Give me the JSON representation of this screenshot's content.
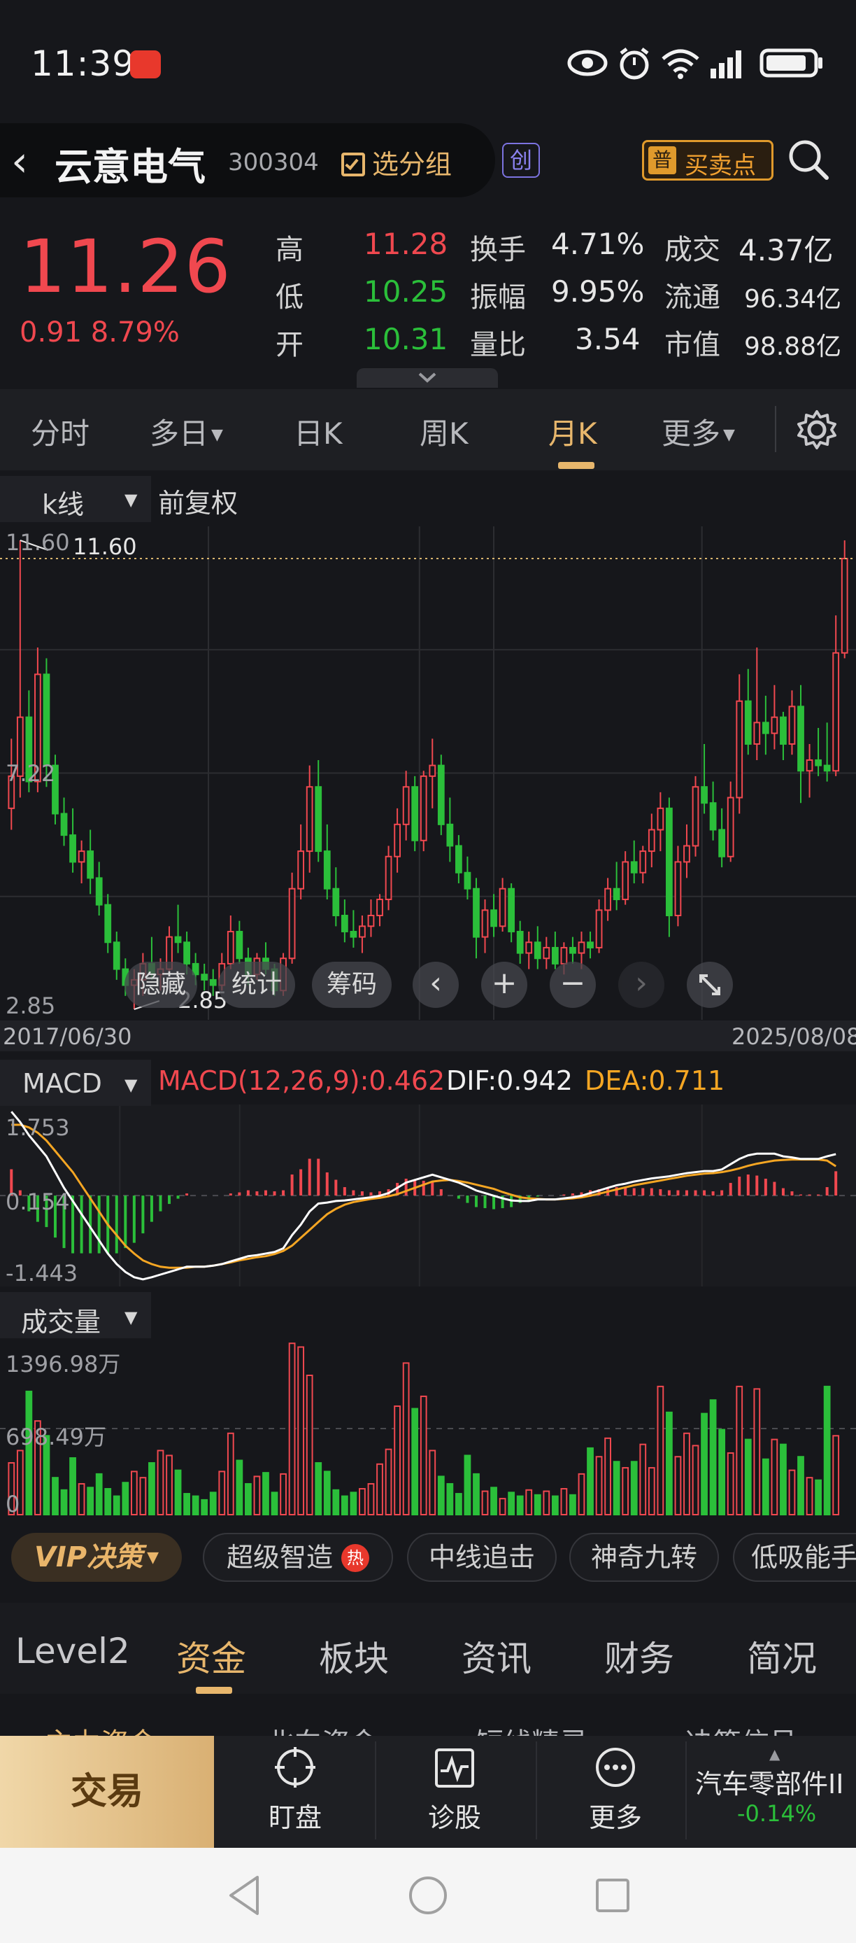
{
  "status_bar": {
    "time": "11:39"
  },
  "header": {
    "name": "云意电气",
    "code": "300304",
    "group_button": "选分组",
    "board_badge": "创",
    "buysell_icon": "普",
    "buysell_label": "买卖点"
  },
  "quote": {
    "price": "11.26",
    "change": "0.91",
    "change_pct": "8.79%",
    "high_label": "高",
    "high": "11.28",
    "low_label": "低",
    "low": "10.25",
    "open_label": "开",
    "open": "10.31",
    "turnover_label": "换手",
    "turnover": "4.71%",
    "amplitude_label": "振幅",
    "amplitude": "9.95%",
    "volratio_label": "量比",
    "volratio": "3.54",
    "amount_label": "成交",
    "amount": "4.37亿",
    "float_label": "流通",
    "float": "96.34亿",
    "mktcap_label": "市值",
    "mktcap": "98.88亿",
    "up_color": "#f0484f",
    "down_color": "#2bbf3a"
  },
  "timeframe_tabs": [
    "分时",
    "多日",
    "日K",
    "周K",
    "月K",
    "更多"
  ],
  "active_timeframe": "月K",
  "kline": {
    "type_select": "k线",
    "adjust": "前复权",
    "price_labels": {
      "top": "11.60",
      "mid": "7.22",
      "bottom": "2.85"
    },
    "max_marker": "11.60",
    "min_marker": "2.85",
    "start_date": "2017/06/30",
    "end_date": "2025/08/08",
    "overlay": {
      "hide": "隐藏",
      "stats": "统计",
      "chips": "筹码"
    }
  },
  "macd": {
    "select": "MACD",
    "label": "MACD(12,26,9):0.462",
    "dif": "DIF:0.942",
    "dea": "DEA:0.711",
    "axis": {
      "top": "1.753",
      "mid": "0.154",
      "bottom": "-1.443"
    },
    "dif_color": "#ffffff",
    "dea_color": "#f5a623"
  },
  "volume": {
    "select": "成交量",
    "axis": {
      "top": "1396.98万",
      "mid": "698.49万",
      "bottom": "0"
    }
  },
  "chips": {
    "vip": "VIP决策",
    "items": [
      "超级智造",
      "中线追击",
      "神奇九转",
      "低吸能手"
    ],
    "hot_badge": "热"
  },
  "lower_tabs": [
    "Level2",
    "资金",
    "板块",
    "资讯",
    "财务",
    "简况"
  ],
  "active_lower_tab": "资金",
  "sub_tabs": [
    "主力资金",
    "北向资金",
    "短线精灵",
    "决策信号"
  ],
  "action_bar": {
    "trade": "交易",
    "watch": "盯盘",
    "diagnose": "诊股",
    "more": "更多",
    "sector_name": "汽车零部件II",
    "sector_change": "-0.14%"
  },
  "chart_data": {
    "type": "candlestick",
    "title": "",
    "period": "monthly",
    "x_start": "2017/06/30",
    "x_end": "2025/08/08",
    "ylim": [
      2.85,
      11.6
    ],
    "candles": [
      {
        "o": 6.6,
        "h": 7.9,
        "l": 6.2,
        "c": 7.2
      },
      {
        "o": 7.2,
        "h": 11.6,
        "l": 6.8,
        "c": 8.3
      },
      {
        "o": 8.3,
        "h": 8.8,
        "l": 6.9,
        "c": 7.1
      },
      {
        "o": 7.1,
        "h": 9.6,
        "l": 6.9,
        "c": 9.1
      },
      {
        "o": 9.1,
        "h": 9.4,
        "l": 7.0,
        "c": 7.4
      },
      {
        "o": 7.4,
        "h": 7.6,
        "l": 6.3,
        "c": 6.5
      },
      {
        "o": 6.5,
        "h": 6.8,
        "l": 5.9,
        "c": 6.1
      },
      {
        "o": 6.1,
        "h": 6.6,
        "l": 5.4,
        "c": 5.6
      },
      {
        "o": 5.6,
        "h": 6.0,
        "l": 5.2,
        "c": 5.8
      },
      {
        "o": 5.8,
        "h": 6.2,
        "l": 5.0,
        "c": 5.3
      },
      {
        "o": 5.3,
        "h": 5.6,
        "l": 4.6,
        "c": 4.8
      },
      {
        "o": 4.8,
        "h": 5.0,
        "l": 3.9,
        "c": 4.1
      },
      {
        "o": 4.1,
        "h": 4.3,
        "l": 3.4,
        "c": 3.6
      },
      {
        "o": 3.6,
        "h": 3.8,
        "l": 3.1,
        "c": 3.3
      },
      {
        "o": 3.3,
        "h": 3.6,
        "l": 2.85,
        "c": 3.4
      },
      {
        "o": 3.4,
        "h": 3.9,
        "l": 3.1,
        "c": 3.7
      },
      {
        "o": 3.7,
        "h": 4.2,
        "l": 3.4,
        "c": 3.5
      },
      {
        "o": 3.5,
        "h": 3.8,
        "l": 3.2,
        "c": 3.6
      },
      {
        "o": 3.6,
        "h": 4.4,
        "l": 3.5,
        "c": 4.2
      },
      {
        "o": 4.2,
        "h": 4.8,
        "l": 3.9,
        "c": 4.1
      },
      {
        "o": 4.1,
        "h": 4.3,
        "l": 3.5,
        "c": 3.7
      },
      {
        "o": 3.7,
        "h": 3.9,
        "l": 3.3,
        "c": 3.5
      },
      {
        "o": 3.5,
        "h": 3.7,
        "l": 3.2,
        "c": 3.4
      },
      {
        "o": 3.4,
        "h": 3.6,
        "l": 3.1,
        "c": 3.3
      },
      {
        "o": 3.3,
        "h": 3.9,
        "l": 3.2,
        "c": 3.7
      },
      {
        "o": 3.7,
        "h": 4.6,
        "l": 3.6,
        "c": 4.3
      },
      {
        "o": 4.3,
        "h": 4.5,
        "l": 3.7,
        "c": 3.8
      },
      {
        "o": 3.8,
        "h": 4.0,
        "l": 3.3,
        "c": 3.5
      },
      {
        "o": 3.5,
        "h": 3.9,
        "l": 3.4,
        "c": 3.8
      },
      {
        "o": 3.8,
        "h": 4.1,
        "l": 3.5,
        "c": 3.6
      },
      {
        "o": 3.6,
        "h": 3.7,
        "l": 3.1,
        "c": 3.2
      },
      {
        "o": 3.2,
        "h": 3.9,
        "l": 3.1,
        "c": 3.8
      },
      {
        "o": 3.8,
        "h": 5.4,
        "l": 3.7,
        "c": 5.1
      },
      {
        "o": 5.1,
        "h": 6.3,
        "l": 4.9,
        "c": 5.8
      },
      {
        "o": 5.8,
        "h": 7.4,
        "l": 5.4,
        "c": 7.0
      },
      {
        "o": 7.0,
        "h": 7.5,
        "l": 5.6,
        "c": 5.8
      },
      {
        "o": 5.8,
        "h": 6.3,
        "l": 4.9,
        "c": 5.1
      },
      {
        "o": 5.1,
        "h": 5.5,
        "l": 4.4,
        "c": 4.6
      },
      {
        "o": 4.6,
        "h": 4.9,
        "l": 4.1,
        "c": 4.3
      },
      {
        "o": 4.3,
        "h": 4.7,
        "l": 4.0,
        "c": 4.2
      },
      {
        "o": 4.2,
        "h": 4.6,
        "l": 3.9,
        "c": 4.4
      },
      {
        "o": 4.4,
        "h": 4.9,
        "l": 4.2,
        "c": 4.6
      },
      {
        "o": 4.6,
        "h": 5.0,
        "l": 4.4,
        "c": 4.9
      },
      {
        "o": 4.9,
        "h": 5.9,
        "l": 4.7,
        "c": 5.7
      },
      {
        "o": 5.7,
        "h": 6.6,
        "l": 5.4,
        "c": 6.3
      },
      {
        "o": 6.3,
        "h": 7.3,
        "l": 6.0,
        "c": 7.0
      },
      {
        "o": 7.0,
        "h": 7.2,
        "l": 5.8,
        "c": 6.0
      },
      {
        "o": 6.0,
        "h": 7.3,
        "l": 5.8,
        "c": 7.2
      },
      {
        "o": 7.2,
        "h": 7.9,
        "l": 6.6,
        "c": 7.4
      },
      {
        "o": 7.4,
        "h": 7.6,
        "l": 6.1,
        "c": 6.3
      },
      {
        "o": 6.3,
        "h": 6.8,
        "l": 5.6,
        "c": 5.9
      },
      {
        "o": 5.9,
        "h": 6.1,
        "l": 5.2,
        "c": 5.4
      },
      {
        "o": 5.4,
        "h": 5.7,
        "l": 4.9,
        "c": 5.1
      },
      {
        "o": 5.1,
        "h": 5.3,
        "l": 3.8,
        "c": 4.2
      },
      {
        "o": 4.2,
        "h": 4.9,
        "l": 3.9,
        "c": 4.7
      },
      {
        "o": 4.7,
        "h": 5.0,
        "l": 4.2,
        "c": 4.4
      },
      {
        "o": 4.4,
        "h": 5.3,
        "l": 4.3,
        "c": 5.1
      },
      {
        "o": 5.1,
        "h": 5.2,
        "l": 4.1,
        "c": 4.3
      },
      {
        "o": 4.3,
        "h": 4.5,
        "l": 3.7,
        "c": 3.9
      },
      {
        "o": 3.9,
        "h": 4.3,
        "l": 3.6,
        "c": 4.1
      },
      {
        "o": 4.1,
        "h": 4.4,
        "l": 3.6,
        "c": 3.8
      },
      {
        "o": 3.8,
        "h": 4.2,
        "l": 3.6,
        "c": 4.0
      },
      {
        "o": 4.0,
        "h": 4.3,
        "l": 3.6,
        "c": 3.7
      },
      {
        "o": 3.7,
        "h": 4.1,
        "l": 3.5,
        "c": 4.0
      },
      {
        "o": 4.0,
        "h": 4.2,
        "l": 3.7,
        "c": 3.9
      },
      {
        "o": 3.9,
        "h": 4.3,
        "l": 3.6,
        "c": 4.1
      },
      {
        "o": 4.1,
        "h": 4.3,
        "l": 3.8,
        "c": 4.0
      },
      {
        "o": 4.0,
        "h": 4.9,
        "l": 3.9,
        "c": 4.7
      },
      {
        "o": 4.7,
        "h": 5.3,
        "l": 4.5,
        "c": 5.1
      },
      {
        "o": 5.1,
        "h": 5.6,
        "l": 4.7,
        "c": 4.9
      },
      {
        "o": 4.9,
        "h": 5.8,
        "l": 4.8,
        "c": 5.6
      },
      {
        "o": 5.6,
        "h": 6.0,
        "l": 5.2,
        "c": 5.4
      },
      {
        "o": 5.4,
        "h": 5.9,
        "l": 5.2,
        "c": 5.8
      },
      {
        "o": 5.8,
        "h": 6.5,
        "l": 5.5,
        "c": 6.2
      },
      {
        "o": 6.2,
        "h": 6.9,
        "l": 5.8,
        "c": 6.6
      },
      {
        "o": 6.6,
        "h": 6.8,
        "l": 4.2,
        "c": 4.6
      },
      {
        "o": 4.6,
        "h": 5.9,
        "l": 4.4,
        "c": 5.6
      },
      {
        "o": 5.6,
        "h": 6.3,
        "l": 5.3,
        "c": 5.9
      },
      {
        "o": 5.9,
        "h": 7.2,
        "l": 5.7,
        "c": 7.0
      },
      {
        "o": 7.0,
        "h": 7.8,
        "l": 6.5,
        "c": 6.7
      },
      {
        "o": 6.7,
        "h": 7.1,
        "l": 6.0,
        "c": 6.2
      },
      {
        "o": 6.2,
        "h": 6.6,
        "l": 5.5,
        "c": 5.7
      },
      {
        "o": 5.7,
        "h": 7.1,
        "l": 5.6,
        "c": 6.8
      },
      {
        "o": 6.8,
        "h": 9.1,
        "l": 6.5,
        "c": 8.6
      },
      {
        "o": 8.6,
        "h": 9.2,
        "l": 7.6,
        "c": 7.8
      },
      {
        "o": 7.8,
        "h": 9.6,
        "l": 7.5,
        "c": 8.2
      },
      {
        "o": 8.2,
        "h": 8.7,
        "l": 7.6,
        "c": 8.0
      },
      {
        "o": 8.0,
        "h": 8.9,
        "l": 7.7,
        "c": 8.3
      },
      {
        "o": 8.3,
        "h": 8.4,
        "l": 7.5,
        "c": 7.8
      },
      {
        "o": 7.8,
        "h": 8.8,
        "l": 7.6,
        "c": 8.5
      },
      {
        "o": 8.5,
        "h": 8.9,
        "l": 6.7,
        "c": 7.3
      },
      {
        "o": 7.3,
        "h": 7.8,
        "l": 6.8,
        "c": 7.5
      },
      {
        "o": 7.5,
        "h": 8.1,
        "l": 7.2,
        "c": 7.4
      },
      {
        "o": 7.4,
        "h": 8.2,
        "l": 7.1,
        "c": 7.3
      },
      {
        "o": 7.3,
        "h": 10.2,
        "l": 7.2,
        "c": 9.5
      },
      {
        "o": 9.5,
        "h": 11.6,
        "l": 9.4,
        "c": 11.26
      }
    ],
    "volume": [
      420,
      520,
      1000,
      760,
      640,
      300,
      200,
      460,
      250,
      220,
      330,
      210,
      150,
      260,
      350,
      300,
      420,
      520,
      480,
      360,
      170,
      150,
      120,
      180,
      350,
      660,
      440,
      250,
      310,
      340,
      180,
      330,
      1390,
      1360,
      1130,
      420,
      350,
      200,
      150,
      180,
      210,
      250,
      410,
      530,
      880,
      1230,
      860,
      960,
      520,
      310,
      250,
      170,
      480,
      330,
      190,
      220,
      130,
      180,
      150,
      200,
      160,
      190,
      150,
      210,
      160,
      330,
      540,
      470,
      620,
      430,
      380,
      430,
      570,
      380,
      1040,
      830,
      470,
      660,
      560,
      820,
      930,
      690,
      500,
      1040,
      610,
      1020,
      450,
      610,
      570,
      360,
      470,
      300,
      280,
      1040,
      640
    ],
    "macd_dif": [
      1.75,
      1.55,
      1.3,
      1.1,
      0.9,
      0.6,
      0.3,
      0.05,
      -0.2,
      -0.45,
      -0.7,
      -0.95,
      -1.15,
      -1.3,
      -1.4,
      -1.44,
      -1.4,
      -1.35,
      -1.3,
      -1.25,
      -1.2,
      -1.2,
      -1.2,
      -1.18,
      -1.15,
      -1.1,
      -1.05,
      -1.0,
      -0.98,
      -0.95,
      -0.92,
      -0.85,
      -0.6,
      -0.4,
      -0.15,
      0.0,
      0.02,
      0.05,
      0.06,
      0.08,
      0.1,
      0.12,
      0.15,
      0.2,
      0.3,
      0.4,
      0.45,
      0.5,
      0.55,
      0.5,
      0.45,
      0.4,
      0.33,
      0.25,
      0.2,
      0.15,
      0.1,
      0.06,
      0.05,
      0.05,
      0.08,
      0.08,
      0.08,
      0.1,
      0.12,
      0.15,
      0.2,
      0.25,
      0.3,
      0.35,
      0.38,
      0.42,
      0.45,
      0.48,
      0.5,
      0.52,
      0.55,
      0.58,
      0.6,
      0.62,
      0.62,
      0.65,
      0.75,
      0.85,
      0.92,
      0.95,
      0.95,
      0.95,
      0.9,
      0.88,
      0.85,
      0.85,
      0.85,
      0.9,
      0.942
    ],
    "macd_dea": [
      1.5,
      1.5,
      1.45,
      1.35,
      1.2,
      1.0,
      0.8,
      0.6,
      0.35,
      0.1,
      -0.15,
      -0.4,
      -0.6,
      -0.8,
      -0.95,
      -1.08,
      -1.15,
      -1.2,
      -1.22,
      -1.22,
      -1.22,
      -1.2,
      -1.2,
      -1.18,
      -1.15,
      -1.12,
      -1.08,
      -1.05,
      -1.02,
      -1.0,
      -0.96,
      -0.9,
      -0.8,
      -0.65,
      -0.5,
      -0.35,
      -0.2,
      -0.1,
      -0.02,
      0.03,
      0.06,
      0.09,
      0.11,
      0.14,
      0.18,
      0.24,
      0.3,
      0.36,
      0.42,
      0.44,
      0.45,
      0.43,
      0.4,
      0.36,
      0.32,
      0.28,
      0.22,
      0.17,
      0.12,
      0.1,
      0.09,
      0.08,
      0.08,
      0.09,
      0.1,
      0.12,
      0.15,
      0.19,
      0.23,
      0.27,
      0.31,
      0.35,
      0.38,
      0.41,
      0.44,
      0.47,
      0.5,
      0.53,
      0.55,
      0.57,
      0.58,
      0.6,
      0.63,
      0.67,
      0.72,
      0.76,
      0.79,
      0.82,
      0.83,
      0.84,
      0.84,
      0.84,
      0.84,
      0.82,
      0.711
    ]
  }
}
